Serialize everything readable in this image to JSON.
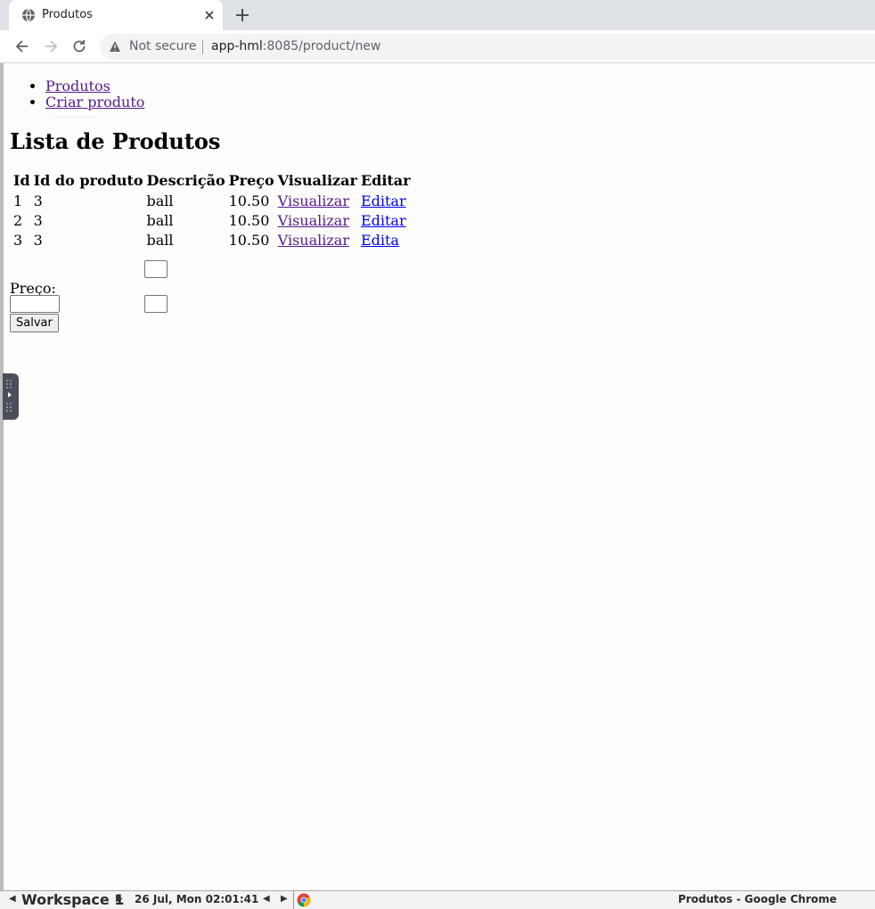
{
  "browser": {
    "tab_title": "Produtos",
    "security_label": "Not secure",
    "url_host": "app-hml",
    "url_path": ":8085/product/new"
  },
  "nav": {
    "items": [
      {
        "label": "Produtos"
      },
      {
        "label": "Criar produto"
      }
    ]
  },
  "page": {
    "heading": "Lista de Produtos"
  },
  "table": {
    "headers": [
      "Id",
      "Id do produto",
      "Descrição",
      "Preço",
      "Visualizar",
      "Editar"
    ],
    "rows": [
      {
        "id": "1",
        "product_id": "3",
        "description": "ball",
        "price": "10.50",
        "view": "Visualizar",
        "edit": "Editar"
      },
      {
        "id": "2",
        "product_id": "3",
        "description": "ball",
        "price": "10.50",
        "view": "Visualizar",
        "edit": "Editar"
      },
      {
        "id": "3",
        "product_id": "3",
        "description": "ball",
        "price": "10.50",
        "view": "Visualizar",
        "edit": "Edita"
      }
    ]
  },
  "form": {
    "price_label": "Preço:",
    "save_label": "Salvar"
  },
  "taskbar": {
    "workspace": "Workspace 1",
    "clock": "26 Jul, Mon 02:01:41",
    "window_title": "Produtos - Google Chrome"
  },
  "colors": {
    "visited_link": "#551a8b",
    "link": "#0000ee",
    "tab_strip": "#dee1e6"
  }
}
